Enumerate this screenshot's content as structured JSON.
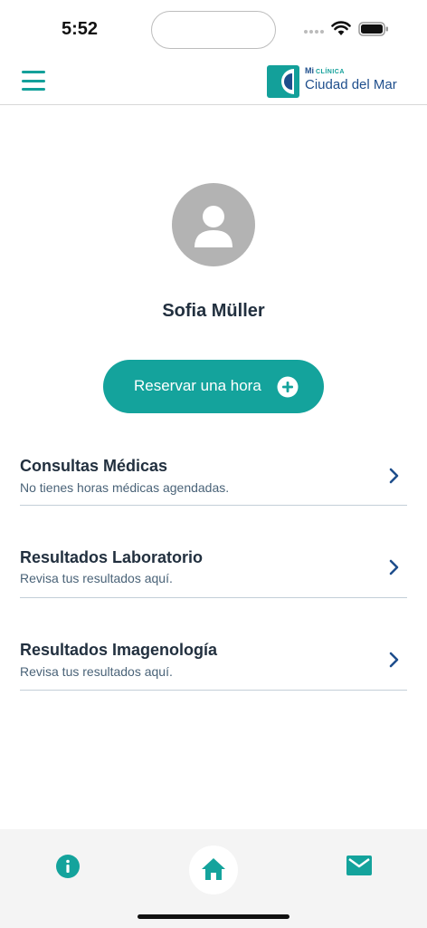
{
  "status_bar": {
    "time": "5:52"
  },
  "header": {
    "logo": {
      "mi": "Mi",
      "clinica": "CLÍNICA",
      "name": "Ciudad del Mar"
    },
    "icons": [
      "menu-icon"
    ]
  },
  "profile": {
    "name": "Sofia Müller",
    "reserve_label": "Reservar una hora"
  },
  "menu": {
    "items": [
      {
        "title": "Consultas Médicas",
        "subtitle": "No tienes horas médicas agendadas."
      },
      {
        "title": "Resultados Laboratorio",
        "subtitle": "Revisa tus resultados aquí."
      },
      {
        "title": "Resultados Imagenología",
        "subtitle": "Revisa tus resultados aquí."
      }
    ]
  },
  "bottom_nav": {
    "items": [
      "info-icon",
      "home-icon",
      "mail-icon"
    ],
    "active": "home-icon"
  },
  "colors": {
    "accent": "#14a39c",
    "brand_blue": "#1e4e8c",
    "text_dark": "#22303f",
    "text_muted": "#4a6378"
  }
}
